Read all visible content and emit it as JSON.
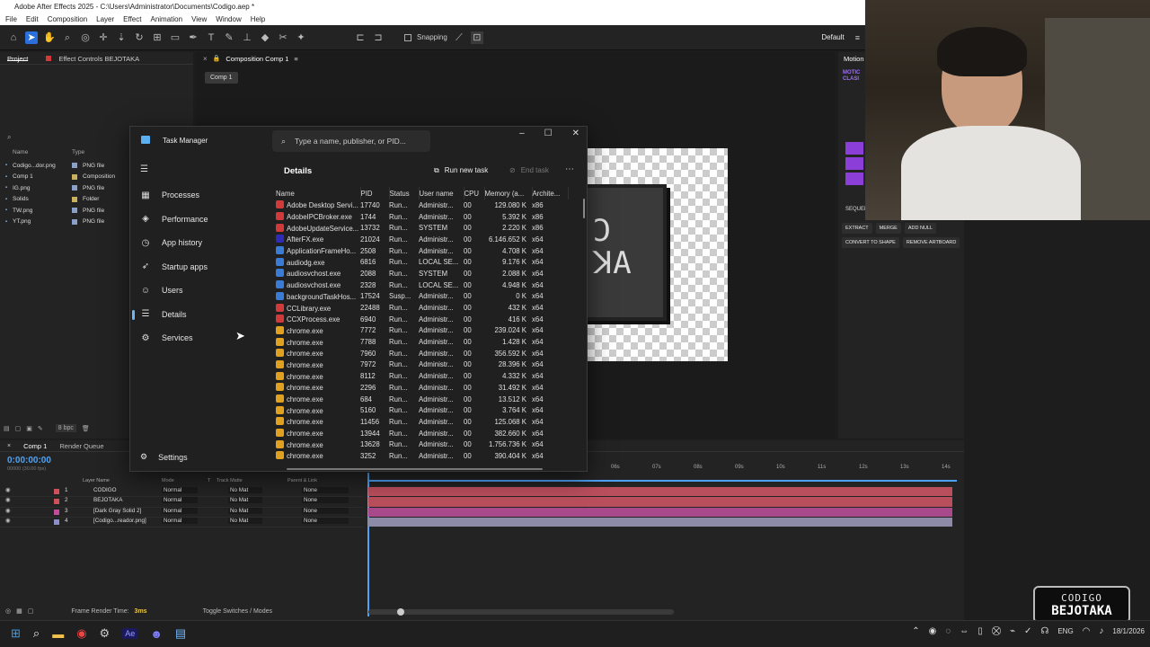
{
  "window": {
    "title": "Adobe After Effects 2025 - C:\\Users\\Administrator\\Documents\\Codigo.aep *"
  },
  "menu": [
    "File",
    "Edit",
    "Composition",
    "Layer",
    "Effect",
    "Animation",
    "View",
    "Window",
    "Help"
  ],
  "toolbar": {
    "snapping": "Snapping",
    "workspace": "Default"
  },
  "project": {
    "tab": "Project",
    "effect_tab": "Effect Controls BEJOTAKA",
    "search_placeholder": "",
    "col_name": "Name",
    "col_type": "Type",
    "items": [
      {
        "name": "Codigo...dor.png",
        "type": "PNG file",
        "color": "#8aa0c8"
      },
      {
        "name": "Comp 1",
        "type": "Composition",
        "color": "#c9b25e"
      },
      {
        "name": "IG.png",
        "type": "PNG file",
        "color": "#8aa0c8"
      },
      {
        "name": "Solids",
        "type": "Folder",
        "color": "#c9b25e"
      },
      {
        "name": "TW.png",
        "type": "PNG file",
        "color": "#8aa0c8"
      },
      {
        "name": "YT.png",
        "type": "PNG file",
        "color": "#8aa0c8"
      }
    ],
    "bpc": "8 bpc"
  },
  "comp": {
    "tab": "Composition Comp 1",
    "breadcrumb": "Comp 1"
  },
  "motion": {
    "tab": "Motion",
    "sequence": "SEQUEN",
    "buttons": [
      "EXTRACT",
      "MERGE",
      "ADD NULL",
      "CONVERT TO SHAPE",
      "REMOVE ARTBOARD"
    ]
  },
  "timeline": {
    "tab": "Comp 1",
    "render_tab": "Render Queue",
    "timecode": "0:00:00:00",
    "fps": "00000 (30.00 fps)",
    "col_layer": "Layer Name",
    "col_mode": "Mode",
    "col_t": "T",
    "col_track": "Track Matte",
    "col_parent": "Parent & Link",
    "layers": [
      {
        "num": "1",
        "name": "CODIGO",
        "mode": "Normal",
        "matte": "No Mat",
        "parent": "None",
        "color": "#d0505a",
        "bar": "#b94e5c"
      },
      {
        "num": "2",
        "name": "BEJOTAKA",
        "mode": "Normal",
        "matte": "No Mat",
        "parent": "None",
        "color": "#d0505a",
        "bar": "#b94e5c"
      },
      {
        "num": "3",
        "name": "[Dark Gray Solid 2]",
        "mode": "Normal",
        "matte": "No Mat",
        "parent": "None",
        "color": "#c24b9c",
        "bar": "#a8498c"
      },
      {
        "num": "4",
        "name": "[Codigo...reador.png]",
        "mode": "Normal",
        "matte": "No Mat",
        "parent": "None",
        "color": "#8a8fc8",
        "bar": "#8d8aa8"
      }
    ],
    "ruler": [
      "06s",
      "07s",
      "08s",
      "09s",
      "10s",
      "11s",
      "12s",
      "13s",
      "14s"
    ],
    "render_time_label": "Frame Render Time:",
    "render_time": "3ms",
    "toggle": "Toggle Switches / Modes"
  },
  "taskmanager": {
    "title": "Task Manager",
    "search_placeholder": "Type a name, publisher, or PID...",
    "section": "Details",
    "run_new_task": "Run new task",
    "end_task": "End task",
    "nav": [
      {
        "label": "Processes",
        "icon": "▦"
      },
      {
        "label": "Performance",
        "icon": "◈"
      },
      {
        "label": "App history",
        "icon": "◷"
      },
      {
        "label": "Startup apps",
        "icon": "➶"
      },
      {
        "label": "Users",
        "icon": "☺"
      },
      {
        "label": "Details",
        "icon": "☰"
      },
      {
        "label": "Services",
        "icon": "⚙"
      }
    ],
    "settings": "Settings",
    "columns": [
      "Name",
      "PID",
      "Status",
      "User name",
      "CPU",
      "Memory (a...",
      "Archite..."
    ],
    "rows": [
      [
        "Adobe Desktop Servi...",
        "17740",
        "Run...",
        "Administr...",
        "00",
        "129.080 K",
        "x86",
        "#d03a3a"
      ],
      [
        "AdobeIPCBroker.exe",
        "1744",
        "Run...",
        "Administr...",
        "00",
        "5.392 K",
        "x86",
        "#d03a3a"
      ],
      [
        "AdobeUpdateService...",
        "13732",
        "Run...",
        "SYSTEM",
        "00",
        "2.220 K",
        "x86",
        "#d03a3a"
      ],
      [
        "AfterFX.exe",
        "21024",
        "Run...",
        "Administr...",
        "00",
        "6.146.652 K",
        "x64",
        "#2d2bb8"
      ],
      [
        "ApplicationFrameHo...",
        "2508",
        "Run...",
        "Administr...",
        "00",
        "4.708 K",
        "x64",
        "#3a7bd5"
      ],
      [
        "audiodg.exe",
        "6816",
        "Run...",
        "LOCAL SE...",
        "00",
        "9.176 K",
        "x64",
        "#3a7bd5"
      ],
      [
        "audiosvchost.exe",
        "2088",
        "Run...",
        "SYSTEM",
        "00",
        "2.088 K",
        "x64",
        "#3a7bd5"
      ],
      [
        "audiosvchost.exe",
        "2328",
        "Run...",
        "LOCAL SE...",
        "00",
        "4.948 K",
        "x64",
        "#3a7bd5"
      ],
      [
        "backgroundTaskHos...",
        "17524",
        "Susp...",
        "Administr...",
        "00",
        "0 K",
        "x64",
        "#3a7bd5"
      ],
      [
        "CCLibrary.exe",
        "22488",
        "Run...",
        "Administr...",
        "00",
        "432 K",
        "x64",
        "#d03a3a"
      ],
      [
        "CCXProcess.exe",
        "6940",
        "Run...",
        "Administr...",
        "00",
        "416 K",
        "x64",
        "#d03a3a"
      ],
      [
        "chrome.exe",
        "7772",
        "Run...",
        "Administr...",
        "00",
        "239.024 K",
        "x64",
        "#e0a020"
      ],
      [
        "chrome.exe",
        "7788",
        "Run...",
        "Administr...",
        "00",
        "1.428 K",
        "x64",
        "#e0a020"
      ],
      [
        "chrome.exe",
        "7960",
        "Run...",
        "Administr...",
        "00",
        "356.592 K",
        "x64",
        "#e0a020"
      ],
      [
        "chrome.exe",
        "7972",
        "Run...",
        "Administr...",
        "00",
        "28.396 K",
        "x64",
        "#e0a020"
      ],
      [
        "chrome.exe",
        "8112",
        "Run...",
        "Administr...",
        "00",
        "4.332 K",
        "x64",
        "#e0a020"
      ],
      [
        "chrome.exe",
        "2296",
        "Run...",
        "Administr...",
        "00",
        "31.492 K",
        "x64",
        "#e0a020"
      ],
      [
        "chrome.exe",
        "684",
        "Run...",
        "Administr...",
        "00",
        "13.512 K",
        "x64",
        "#e0a020"
      ],
      [
        "chrome.exe",
        "5160",
        "Run...",
        "Administr...",
        "00",
        "3.764 K",
        "x64",
        "#e0a020"
      ],
      [
        "chrome.exe",
        "11456",
        "Run...",
        "Administr...",
        "00",
        "125.068 K",
        "x64",
        "#e0a020"
      ],
      [
        "chrome.exe",
        "13944",
        "Run...",
        "Administr...",
        "00",
        "382.660 K",
        "x64",
        "#e0a020"
      ],
      [
        "chrome.exe",
        "13628",
        "Run...",
        "Administr...",
        "00",
        "1.756.736 K",
        "x64",
        "#e0a020"
      ],
      [
        "chrome.exe",
        "3252",
        "Run...",
        "Administr...",
        "00",
        "390.404 K",
        "x64",
        "#e0a020"
      ]
    ]
  },
  "watermark": {
    "line1": "CODIGO",
    "line2": "BEJOTAKA"
  },
  "system_tray": {
    "lang": "ENG",
    "time": "18/1/2026"
  }
}
